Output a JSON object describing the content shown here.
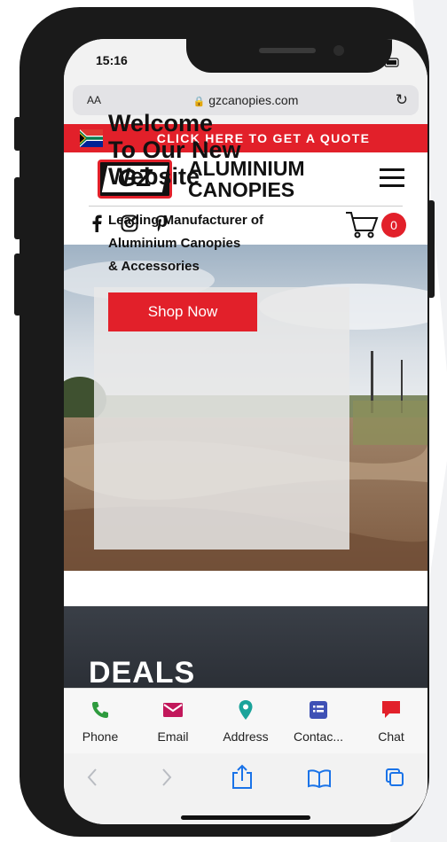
{
  "status": {
    "time": "15:16"
  },
  "browser": {
    "aa_label": "AA",
    "url": "gzcanopies.com"
  },
  "banner": {
    "quote_text": "CLICK HERE TO GET A QUOTE"
  },
  "header": {
    "logo_text": "GZ",
    "brand_line1": "ALUMINIUM",
    "brand_line2": "CANOPIES",
    "cart_count": "0",
    "social_icons": [
      "facebook-icon",
      "instagram-icon",
      "pinterest-icon"
    ]
  },
  "hero": {
    "title_line1": "Welcome",
    "title_line2": "To Our New",
    "title_line3": "Website",
    "subtitle_line1": "Leading Manufacturer of",
    "subtitle_line2": "Aluminium Canopies",
    "subtitle_line3": "& Accessories",
    "button_label": "Shop Now"
  },
  "deals": {
    "title": "DEALS"
  },
  "tabbar": {
    "items": [
      {
        "label": "Phone",
        "icon": "phone-icon",
        "color": "#2e9b3e"
      },
      {
        "label": "Email",
        "icon": "email-icon",
        "color": "#c2185b"
      },
      {
        "label": "Address",
        "icon": "map-pin-icon",
        "color": "#1aa39a"
      },
      {
        "label": "Contac...",
        "icon": "contact-form-icon",
        "color": "#3f51b5"
      },
      {
        "label": "Chat",
        "icon": "chat-icon",
        "color": "#e2202a"
      }
    ]
  },
  "colors": {
    "accent": "#e2202a",
    "ios_blue": "#1a73e8"
  }
}
